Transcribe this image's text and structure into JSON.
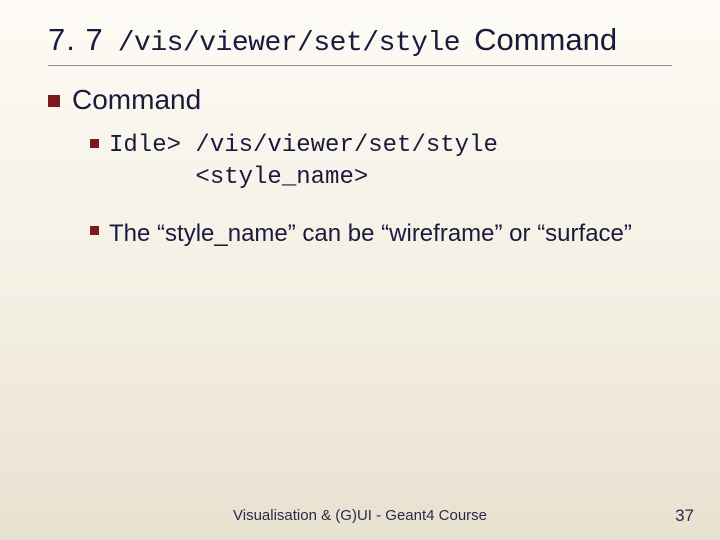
{
  "title": {
    "number": "7. 7",
    "command": "/vis/viewer/set/style",
    "suffix": "Command"
  },
  "body": {
    "heading": "Command",
    "code_prompt": "Idle> ",
    "code_cmd": "/vis/viewer/set/style",
    "code_arg": "<style_name>",
    "desc_pre": "The ",
    "desc_q1": "“style_name”",
    "desc_mid": " can be ",
    "desc_q2": "“wireframe”",
    "desc_or": " or ",
    "desc_q3": "“surface”"
  },
  "footer": {
    "text": "Visualisation & (G)UI - Geant4 Course",
    "page": "37"
  }
}
